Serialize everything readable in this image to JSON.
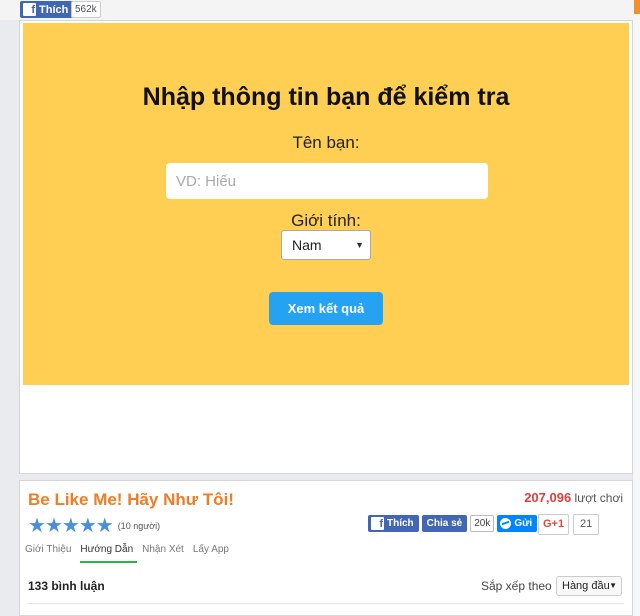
{
  "fb_like": {
    "label": "Thích",
    "count": "562k",
    "icon": "facebook-f-icon"
  },
  "form": {
    "title": "Nhập thông tin bạn để kiểm tra",
    "name_label": "Tên bạn:",
    "name_placeholder": "VD: Hiếu",
    "name_value": "",
    "gender_label": "Giới tính:",
    "gender_selected": "Nam",
    "submit_label": "Xem kết quả"
  },
  "game": {
    "title": "Be Like Me! Hãy Như Tôi!",
    "plays": "207,096",
    "plays_suffix": "lượt chơi",
    "rating_stars": 5,
    "rating_count": "(10 người)",
    "tabs": [
      "Giới Thiệu",
      "Hướng Dẫn",
      "Nhận Xét",
      "Lấy App"
    ],
    "active_tab": "Hướng Dẫn"
  },
  "social": {
    "like_label": "Thích",
    "share_label": "Chia sẻ",
    "share_count": "20k",
    "send_label": "Gửi",
    "gplus_label": "G+1",
    "gplus_count": "21"
  },
  "comments": {
    "count_label": "133 bình luận",
    "sort_label": "Sắp xếp theo",
    "sort_value": "Hàng đầu"
  },
  "colors": {
    "banner": "#ffcf54",
    "button": "#25a3f2",
    "game_title": "#f07c24",
    "plays_number": "#e23d3d",
    "facebook": "#4267b2",
    "active_tab_underline": "#2bb34a"
  }
}
